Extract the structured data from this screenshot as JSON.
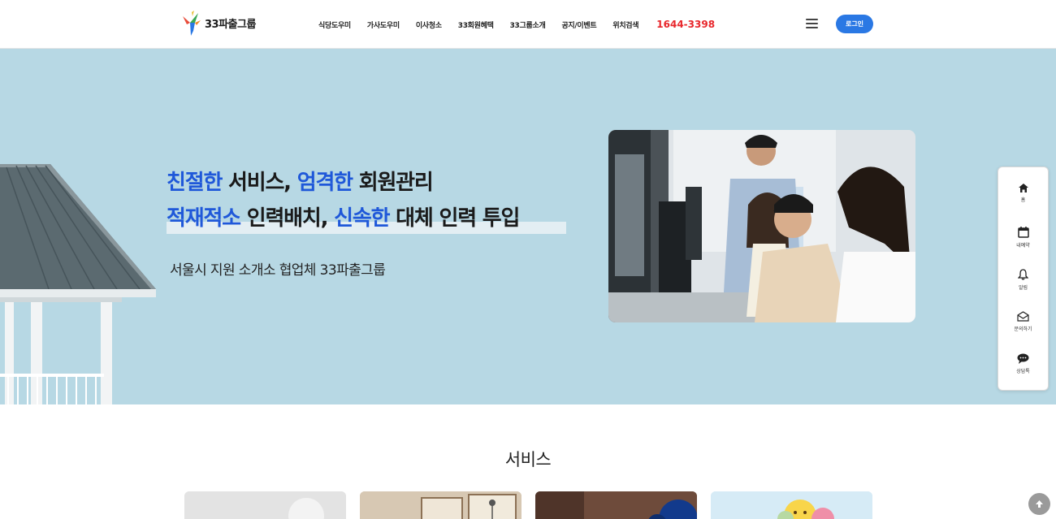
{
  "header": {
    "logo_text": "33파출그룹",
    "nav": [
      "식당도우미",
      "가사도우미",
      "이사청소",
      "33회원혜택",
      "33그룹소개",
      "공지/이벤트",
      "위치검색"
    ],
    "phone": "1644-3398",
    "login_label": "로그인",
    "menu_icon": "hamburger-icon"
  },
  "hero": {
    "line1": [
      {
        "text": "친절한",
        "accent": true
      },
      {
        "text": " 서비스, ",
        "accent": false
      },
      {
        "text": "엄격한",
        "accent": true
      },
      {
        "text": " 회원관리",
        "accent": false
      }
    ],
    "line2": [
      {
        "text": "적재적소",
        "accent": true
      },
      {
        "text": " 인력배치, ",
        "accent": false
      },
      {
        "text": "신속한",
        "accent": true
      },
      {
        "text": " 대체 인력 투입",
        "accent": false
      }
    ],
    "subline": "서울시 지원 소개소 협업체 33파출그룹",
    "accent_color": "#1f58d9",
    "background_color": "#b7d8e4"
  },
  "quick_menu": {
    "items": [
      {
        "label": "홈",
        "icon": "home-icon"
      },
      {
        "label": "내예약",
        "icon": "calendar-icon"
      },
      {
        "label": "알림",
        "icon": "bell-icon"
      },
      {
        "label": "문의하기",
        "icon": "mail-icon"
      },
      {
        "label": "상담톡",
        "icon": "chat-icon"
      }
    ]
  },
  "section": {
    "title": "서비스"
  },
  "colors": {
    "brand": "#2a78e4",
    "phone": "#e8262b"
  }
}
